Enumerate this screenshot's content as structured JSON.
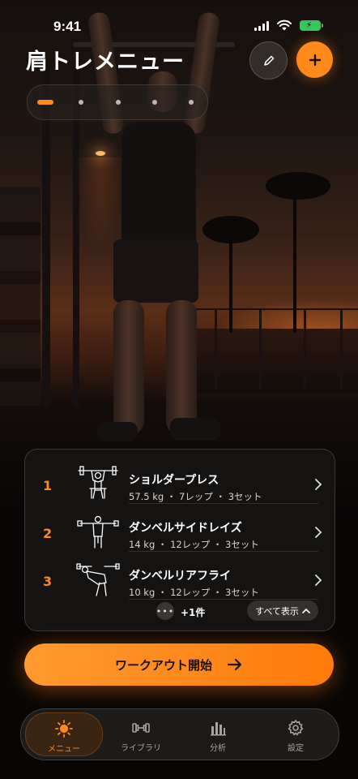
{
  "status": {
    "time": "9:41"
  },
  "header": {
    "title": "肩トレメニュー"
  },
  "pager": {
    "count": 5,
    "active_index": 0
  },
  "exercises": [
    {
      "index": "1",
      "name": "ショルダープレス",
      "weight": "57.5 kg",
      "reps": "7レップ",
      "sets": "3セット"
    },
    {
      "index": "2",
      "name": "ダンベルサイドレイズ",
      "weight": "14 kg",
      "reps": "12レップ",
      "sets": "3セット"
    },
    {
      "index": "3",
      "name": "ダンベルリアフライ",
      "weight": "10 kg",
      "reps": "12レップ",
      "sets": "3セット"
    }
  ],
  "meta_separator": "・",
  "more": {
    "icon": "ellipsis-icon",
    "label": "+1件"
  },
  "show_all": {
    "label": "すべて表示"
  },
  "start_button": {
    "label": "ワークアウト開始"
  },
  "tabs": [
    {
      "label": "メニュー",
      "icon": "sun-icon",
      "active": true
    },
    {
      "label": "ライブラリ",
      "icon": "dumbbell-icon",
      "active": false
    },
    {
      "label": "分析",
      "icon": "bar-chart-icon",
      "active": false
    },
    {
      "label": "設定",
      "icon": "gear-icon",
      "active": false
    }
  ],
  "colors": {
    "accent": "#ff8a1a",
    "battery": "#35c759",
    "background": "#0b0807"
  }
}
